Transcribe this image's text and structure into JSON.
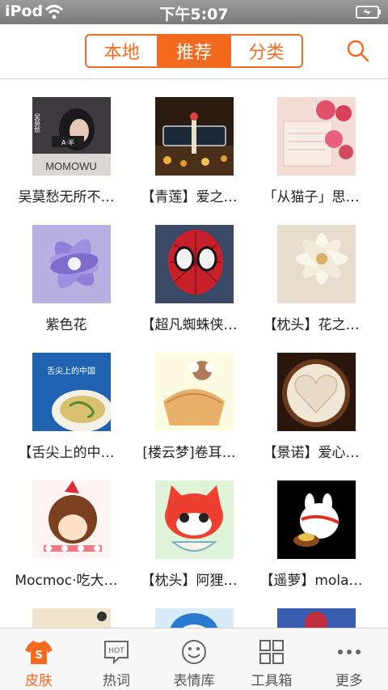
{
  "status_bar": {
    "carrier": "iPod",
    "time": "下午5:07"
  },
  "nav": {
    "tabs": [
      {
        "label": "本地",
        "active": false
      },
      {
        "label": "推荐",
        "active": true
      },
      {
        "label": "分类",
        "active": false
      }
    ],
    "search_icon": "search-icon"
  },
  "skins": [
    {
      "title": "吴莫愁无所不…",
      "thumb_text": "MOMOWU",
      "thumb_badge": "A·半",
      "thumb_vertical": "吴莫愁"
    },
    {
      "title": "【青莲】爱之…"
    },
    {
      "title": "「从猫子」思…"
    },
    {
      "title": "紫色花"
    },
    {
      "title": "【超凡蜘蛛侠…"
    },
    {
      "title": "【枕头】花之…"
    },
    {
      "title": "【舌尖上的中…",
      "thumb_text": "舌尖上的中国"
    },
    {
      "title": "[楼云梦]卷耳…"
    },
    {
      "title": "【景诺】爱心…"
    },
    {
      "title": "Mocmoc·吃大…"
    },
    {
      "title": "【枕头】阿狸…"
    },
    {
      "title": "【遥萝】mola…"
    }
  ],
  "tabbar": {
    "items": [
      {
        "label": "皮肤",
        "icon": "tshirt-icon",
        "active": true,
        "icon_text": "S"
      },
      {
        "label": "热词",
        "icon": "hot-bubble-icon",
        "active": false,
        "icon_text": "HOT"
      },
      {
        "label": "表情库",
        "icon": "smiley-icon",
        "active": false
      },
      {
        "label": "工具箱",
        "icon": "grid-icon",
        "active": false
      },
      {
        "label": "更多",
        "icon": "more-dots-icon",
        "active": false
      }
    ]
  },
  "colors": {
    "accent": "#f36a1e",
    "status_bar": "#888888"
  }
}
